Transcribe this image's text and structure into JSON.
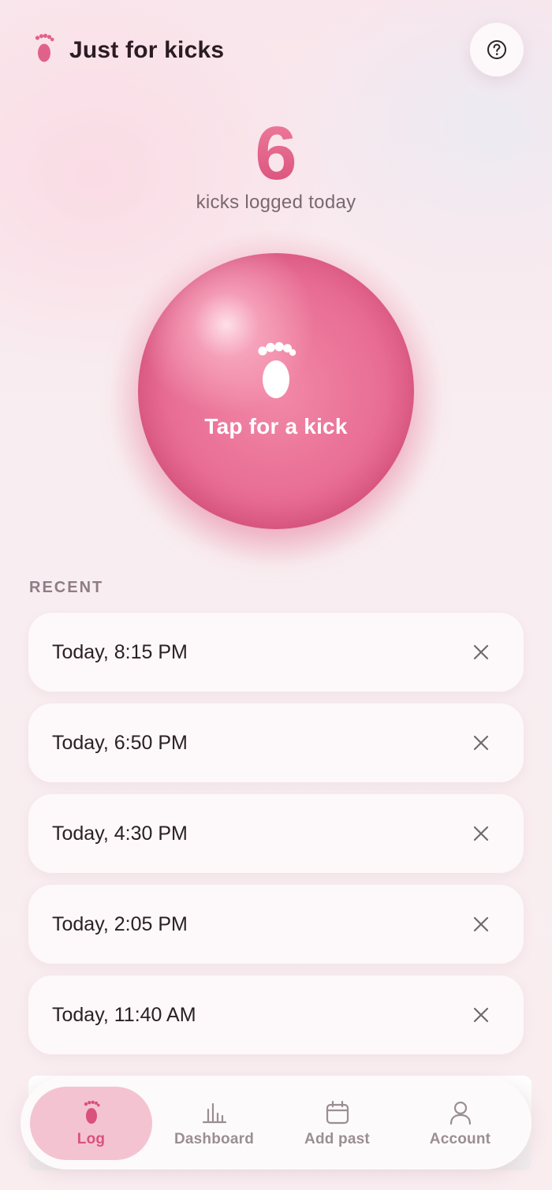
{
  "header": {
    "title": "Just for kicks",
    "logo_icon": "footprint-icon",
    "help_icon": "question-circle-icon"
  },
  "counter": {
    "count": "6",
    "caption": "kicks logged today"
  },
  "tap_button": {
    "label": "Tap for a kick",
    "icon": "footprint-icon"
  },
  "recent": {
    "heading": "RECENT",
    "items": [
      {
        "time": "Today, 8:15 PM"
      },
      {
        "time": "Today, 6:50 PM"
      },
      {
        "time": "Today, 4:30 PM"
      },
      {
        "time": "Today, 2:05 PM"
      },
      {
        "time": "Today, 11:40 AM"
      }
    ],
    "delete_icon": "close-icon"
  },
  "nav": {
    "items": [
      {
        "label": "Log",
        "icon": "footprint-icon",
        "active": true
      },
      {
        "label": "Dashboard",
        "icon": "bar-chart-icon",
        "active": false
      },
      {
        "label": "Add past",
        "icon": "calendar-icon",
        "active": false
      },
      {
        "label": "Account",
        "icon": "user-icon",
        "active": false
      }
    ]
  },
  "colors": {
    "accent": "#e0628a",
    "accent_dark": "#d9517d",
    "nav_active_bg": "#f4c3d1",
    "text_primary": "#2a1c22",
    "text_muted": "#7a6870"
  }
}
